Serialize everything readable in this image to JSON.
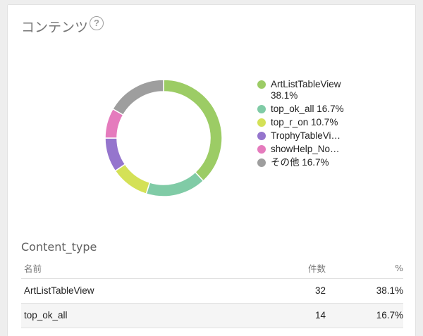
{
  "card": {
    "title": "コンテンツ",
    "help_glyph": "?"
  },
  "chart_data": {
    "type": "pie",
    "donut": true,
    "legend_position": "right",
    "series": [
      {
        "name": "ArtListTableView",
        "label": "ArtListTableView 38.1%",
        "value": 38.1,
        "color": "#9ccc65"
      },
      {
        "name": "top_ok_all",
        "label": "top_ok_all 16.7%",
        "value": 16.7,
        "color": "#80cba6"
      },
      {
        "name": "top_r_on",
        "label": "top_r_on 10.7%",
        "value": 10.7,
        "color": "#d4e157"
      },
      {
        "name": "TrophyTableVi…",
        "label": "TrophyTableVi…",
        "value": 9.5,
        "color": "#9575cd"
      },
      {
        "name": "showHelp_No…",
        "label": "showHelp_No…",
        "value": 8.3,
        "color": "#e57bbd"
      },
      {
        "name": "その他",
        "label": "その他 16.7%",
        "value": 16.7,
        "color": "#9e9e9e"
      }
    ]
  },
  "table": {
    "title": "Content_type",
    "headers": {
      "name": "名前",
      "count": "件数",
      "pct": "%"
    },
    "rows": [
      {
        "name": "ArtListTableView",
        "count": "32",
        "pct": "38.1%"
      },
      {
        "name": "top_ok_all",
        "count": "14",
        "pct": "16.7%"
      }
    ]
  }
}
